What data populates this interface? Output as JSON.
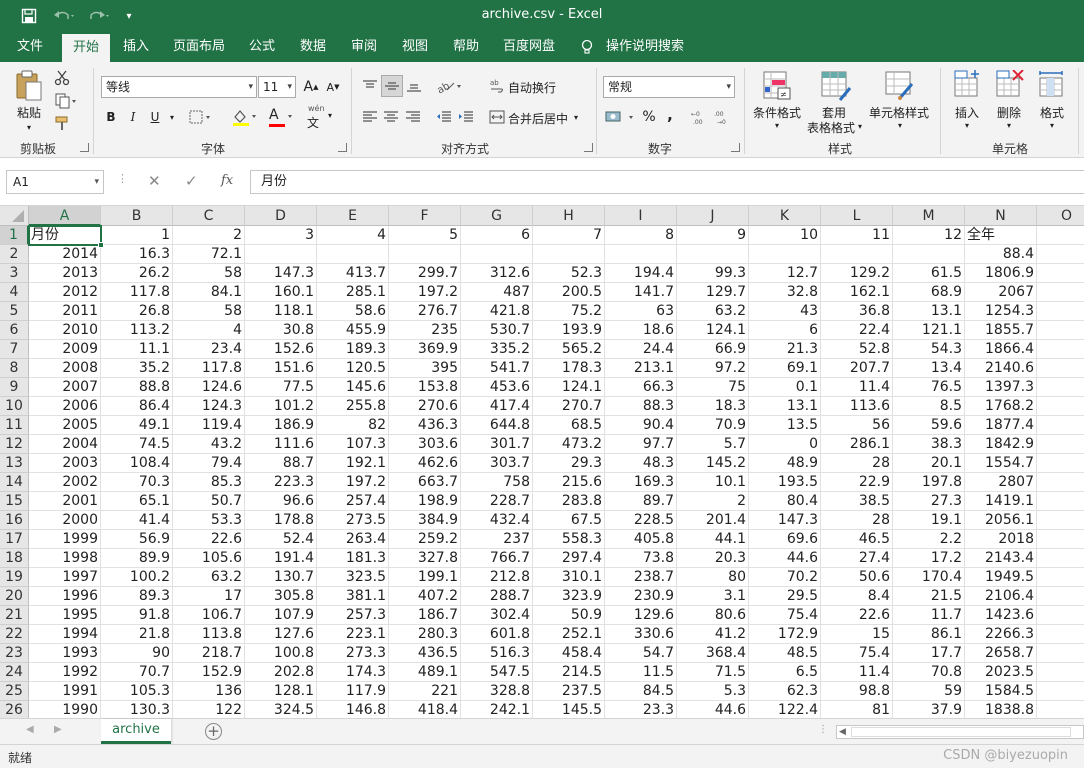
{
  "app": {
    "window_title": "archive.csv  -  Excel"
  },
  "quick_access": {
    "save_icon": "save-icon",
    "undo_icon": "undo-icon",
    "redo_icon": "redo-icon",
    "customize_icon": "customize-qat-icon"
  },
  "tabs": [
    "文件",
    "开始",
    "插入",
    "页面布局",
    "公式",
    "数据",
    "审阅",
    "视图",
    "帮助",
    "百度网盘",
    "操作说明搜索"
  ],
  "ribbon": {
    "clipboard": {
      "paste": "粘贴",
      "label": "剪贴板"
    },
    "font": {
      "name": "等线",
      "size": "11",
      "bold": "B",
      "italic": "I",
      "underline": "U",
      "label": "字体",
      "font_color_glyph": "A",
      "phonetic_glyph": "wén"
    },
    "alignment": {
      "wrap": "自动换行",
      "merge": "合并后居中",
      "label": "对齐方式"
    },
    "number": {
      "format": "常规",
      "percent": "%",
      "comma": ",",
      "label": "数字"
    },
    "styles": {
      "conditional": "条件格式",
      "table_line1": "套用",
      "table_line2": "表格格式",
      "cell_styles": "单元格样式",
      "label": "样式"
    },
    "cells": {
      "insert": "插入",
      "delete": "删除",
      "format": "格式",
      "label": "单元格"
    }
  },
  "formula_bar": {
    "name_box": "A1",
    "fx": "fx",
    "value": "月份"
  },
  "grid": {
    "columns": [
      "A",
      "B",
      "C",
      "D",
      "E",
      "F",
      "G",
      "H",
      "I",
      "J",
      "K",
      "L",
      "M",
      "N",
      "O"
    ],
    "row_numbers": [
      "1",
      "2",
      "3",
      "4",
      "5",
      "6",
      "7",
      "8",
      "9",
      "10",
      "11",
      "12",
      "13",
      "14",
      "15",
      "16",
      "17",
      "18",
      "19",
      "20",
      "21",
      "22",
      "23",
      "24",
      "25",
      "26"
    ],
    "rows": [
      [
        "月份",
        "1",
        "2",
        "3",
        "4",
        "5",
        "6",
        "7",
        "8",
        "9",
        "10",
        "11",
        "12",
        "全年"
      ],
      [
        "2014",
        "16.3",
        "72.1",
        "",
        "",
        "",
        "",
        "",
        "",
        "",
        "",
        "",
        "",
        "88.4"
      ],
      [
        "2013",
        "26.2",
        "58",
        "147.3",
        "413.7",
        "299.7",
        "312.6",
        "52.3",
        "194.4",
        "99.3",
        "12.7",
        "129.2",
        "61.5",
        "1806.9"
      ],
      [
        "2012",
        "117.8",
        "84.1",
        "160.1",
        "285.1",
        "197.2",
        "487",
        "200.5",
        "141.7",
        "129.7",
        "32.8",
        "162.1",
        "68.9",
        "2067"
      ],
      [
        "2011",
        "26.8",
        "58",
        "118.1",
        "58.6",
        "276.7",
        "421.8",
        "75.2",
        "63",
        "63.2",
        "43",
        "36.8",
        "13.1",
        "1254.3"
      ],
      [
        "2010",
        "113.2",
        "4",
        "30.8",
        "455.9",
        "235",
        "530.7",
        "193.9",
        "18.6",
        "124.1",
        "6",
        "22.4",
        "121.1",
        "1855.7"
      ],
      [
        "2009",
        "11.1",
        "23.4",
        "152.6",
        "189.3",
        "369.9",
        "335.2",
        "565.2",
        "24.4",
        "66.9",
        "21.3",
        "52.8",
        "54.3",
        "1866.4"
      ],
      [
        "2008",
        "35.2",
        "117.8",
        "151.6",
        "120.5",
        "395",
        "541.7",
        "178.3",
        "213.1",
        "97.2",
        "69.1",
        "207.7",
        "13.4",
        "2140.6"
      ],
      [
        "2007",
        "88.8",
        "124.6",
        "77.5",
        "145.6",
        "153.8",
        "453.6",
        "124.1",
        "66.3",
        "75",
        "0.1",
        "11.4",
        "76.5",
        "1397.3"
      ],
      [
        "2006",
        "86.4",
        "124.3",
        "101.2",
        "255.8",
        "270.6",
        "417.4",
        "270.7",
        "88.3",
        "18.3",
        "13.1",
        "113.6",
        "8.5",
        "1768.2"
      ],
      [
        "2005",
        "49.1",
        "119.4",
        "186.9",
        "82",
        "436.3",
        "644.8",
        "68.5",
        "90.4",
        "70.9",
        "13.5",
        "56",
        "59.6",
        "1877.4"
      ],
      [
        "2004",
        "74.5",
        "43.2",
        "111.6",
        "107.3",
        "303.6",
        "301.7",
        "473.2",
        "97.7",
        "5.7",
        "0",
        "286.1",
        "38.3",
        "1842.9"
      ],
      [
        "2003",
        "108.4",
        "79.4",
        "88.7",
        "192.1",
        "462.6",
        "303.7",
        "29.3",
        "48.3",
        "145.2",
        "48.9",
        "28",
        "20.1",
        "1554.7"
      ],
      [
        "2002",
        "70.3",
        "85.3",
        "223.3",
        "197.2",
        "663.7",
        "758",
        "215.6",
        "169.3",
        "10.1",
        "193.5",
        "22.9",
        "197.8",
        "2807"
      ],
      [
        "2001",
        "65.1",
        "50.7",
        "96.6",
        "257.4",
        "198.9",
        "228.7",
        "283.8",
        "89.7",
        "2",
        "80.4",
        "38.5",
        "27.3",
        "1419.1"
      ],
      [
        "2000",
        "41.4",
        "53.3",
        "178.8",
        "273.5",
        "384.9",
        "432.4",
        "67.5",
        "228.5",
        "201.4",
        "147.3",
        "28",
        "19.1",
        "2056.1"
      ],
      [
        "1999",
        "56.9",
        "22.6",
        "52.4",
        "263.4",
        "259.2",
        "237",
        "558.3",
        "405.8",
        "44.1",
        "69.6",
        "46.5",
        "2.2",
        "2018"
      ],
      [
        "1998",
        "89.9",
        "105.6",
        "191.4",
        "181.3",
        "327.8",
        "766.7",
        "297.4",
        "73.8",
        "20.3",
        "44.6",
        "27.4",
        "17.2",
        "2143.4"
      ],
      [
        "1997",
        "100.2",
        "63.2",
        "130.7",
        "323.5",
        "199.1",
        "212.8",
        "310.1",
        "238.7",
        "80",
        "70.2",
        "50.6",
        "170.4",
        "1949.5"
      ],
      [
        "1996",
        "89.3",
        "17",
        "305.8",
        "381.1",
        "407.2",
        "288.7",
        "323.9",
        "230.9",
        "3.1",
        "29.5",
        "8.4",
        "21.5",
        "2106.4"
      ],
      [
        "1995",
        "91.8",
        "106.7",
        "107.9",
        "257.3",
        "186.7",
        "302.4",
        "50.9",
        "129.6",
        "80.6",
        "75.4",
        "22.6",
        "11.7",
        "1423.6"
      ],
      [
        "1994",
        "21.8",
        "113.8",
        "127.6",
        "223.1",
        "280.3",
        "601.8",
        "252.1",
        "330.6",
        "41.2",
        "172.9",
        "15",
        "86.1",
        "2266.3"
      ],
      [
        "1993",
        "90",
        "218.7",
        "100.8",
        "273.3",
        "436.5",
        "516.3",
        "458.4",
        "54.7",
        "368.4",
        "48.5",
        "75.4",
        "17.7",
        "2658.7"
      ],
      [
        "1992",
        "70.7",
        "152.9",
        "202.8",
        "174.3",
        "489.1",
        "547.5",
        "214.5",
        "11.5",
        "71.5",
        "6.5",
        "11.4",
        "70.8",
        "2023.5"
      ],
      [
        "1991",
        "105.3",
        "136",
        "128.1",
        "117.9",
        "221",
        "328.8",
        "237.5",
        "84.5",
        "5.3",
        "62.3",
        "98.8",
        "59",
        "1584.5"
      ],
      [
        "1990",
        "130.3",
        "122",
        "324.5",
        "146.8",
        "418.4",
        "242.1",
        "145.5",
        "23.3",
        "44.6",
        "122.4",
        "81",
        "37.9",
        "1838.8"
      ]
    ]
  },
  "sheets": {
    "active": "archive",
    "add_icon": "add-sheet-icon"
  },
  "status": {
    "text": "就绪",
    "watermark": "CSDN @biyezuopin"
  },
  "colors": {
    "brand": "#217346",
    "ribbon_bg": "#f3f3f3"
  }
}
